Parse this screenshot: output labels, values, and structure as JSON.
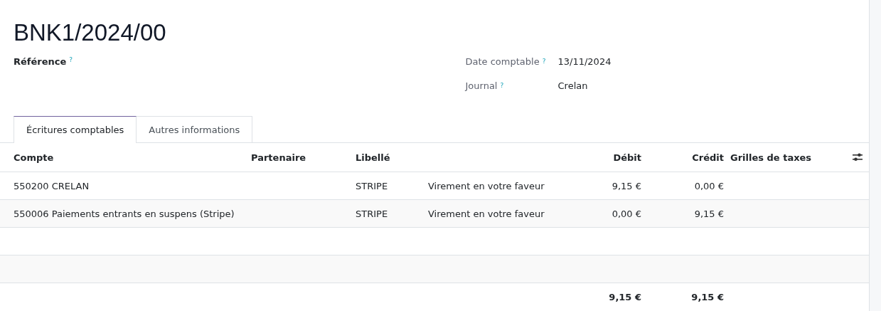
{
  "title": "BNK1/2024/00",
  "fields_left": [
    {
      "label": "Référence",
      "help": "?"
    }
  ],
  "fields_right": [
    {
      "label": "Date comptable",
      "help": "?",
      "value": "13/11/2024"
    },
    {
      "label": "Journal",
      "help": "?",
      "value": "Crelan"
    }
  ],
  "tabs": [
    {
      "label": "Écritures comptables",
      "selected": true
    },
    {
      "label": "Autres informations",
      "selected": false
    }
  ],
  "table": {
    "columns": [
      "Compte",
      "Partenaire",
      "Libellé",
      "",
      "Débit",
      "Crédit",
      "Grilles de taxes"
    ],
    "rows": [
      {
        "kind": "line",
        "cells": [
          "550200 CRELAN",
          "",
          "STRIPE",
          "Virement en votre faveur",
          "9,15 €",
          "0,00 €",
          ""
        ]
      },
      {
        "kind": "line",
        "cells": [
          "550006 Paiements entrants en suspens (Stripe)",
          "",
          "STRIPE",
          "Virement en votre faveur",
          "0,00 €",
          "9,15 €",
          ""
        ]
      },
      {
        "kind": "empty"
      },
      {
        "kind": "empty"
      }
    ],
    "totals": {
      "debit": "9,15 €",
      "credit": "9,15 €"
    }
  }
}
